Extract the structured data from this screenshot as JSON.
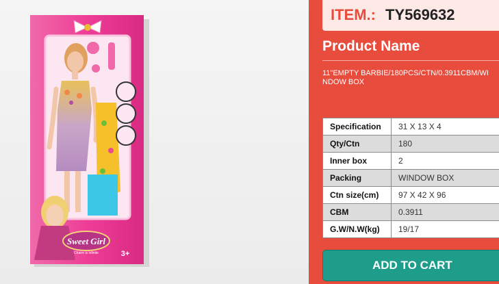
{
  "item": {
    "label": "ITEM.:",
    "code": "TY569632"
  },
  "product": {
    "name_label": "Product Name",
    "description": "11\"EMPTY BARBIE/180PCS/CTN/0.3911CBM/WINDOW BOX"
  },
  "specs": [
    {
      "key": "Specification",
      "value": "31 X 13 X 4"
    },
    {
      "key": "Qty/Ctn",
      "value": "180"
    },
    {
      "key": "Inner box",
      "value": "2"
    },
    {
      "key": "Packing",
      "value": "WINDOW BOX"
    },
    {
      "key": "Ctn size(cm)",
      "value": "97 X 42 X 96"
    },
    {
      "key": "CBM",
      "value": "0.3911"
    },
    {
      "key": "G.W/N.W(kg)",
      "value": "19/17"
    }
  ],
  "cart": {
    "label": "ADD TO CART"
  },
  "packaging": {
    "brand": "Sweet Girl",
    "tagline": "Charm is infinite",
    "age": "3+"
  },
  "colors": {
    "panel": "#e84c3d",
    "item_box": "#fde9e6",
    "cart_button": "#1e9e8a",
    "box_pink": "#ee3d96"
  }
}
